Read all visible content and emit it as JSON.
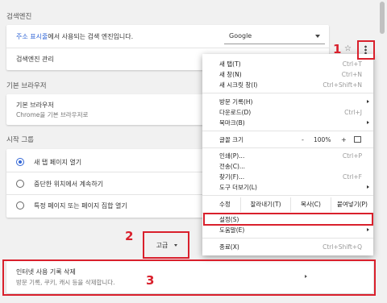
{
  "search_engine": {
    "section_title": "검색엔진",
    "row1": {
      "link": "주소 표시줄",
      "rest": "에서 사용되는 검색 엔진입니다.",
      "value": "Google"
    },
    "row2": {
      "label": "검색엔진 관리"
    }
  },
  "default_browser": {
    "section_title": "기본 브라우저",
    "title": "기본 브라우저",
    "subtitle": "Chrome을 기본 브라우저로"
  },
  "startup": {
    "section_title": "시작 그룹",
    "options": [
      "새 탭 페이지 열기",
      "중단한 위치에서 계속하기",
      "특정 페이지 또는 페이지 집합 열기"
    ],
    "selected_index": 0
  },
  "advanced": {
    "label": "고급"
  },
  "clear_data": {
    "title": "인터넷 사용 기록 삭제",
    "subtitle": "방문 기록, 쿠키, 캐시 등을 삭제합니다."
  },
  "menu": {
    "items_top": [
      {
        "label": "새 탭(T)",
        "shortcut": "Ctrl+T"
      },
      {
        "label": "새 창(N)",
        "shortcut": "Ctrl+N"
      },
      {
        "label": "새 시크릿 창(I)",
        "shortcut": "Ctrl+Shift+N"
      }
    ],
    "items_mid": [
      {
        "label": "방문 기록(H)",
        "shortcut": ""
      },
      {
        "label": "다운로드(D)",
        "shortcut": "Ctrl+J"
      },
      {
        "label": "북마크(B)",
        "shortcut": ""
      }
    ],
    "zoom": {
      "label": "글꼴 크기",
      "minus": "-",
      "value": "100%",
      "plus": "+"
    },
    "items_tools": [
      {
        "label": "인쇄(P)...",
        "shortcut": "Ctrl+P"
      },
      {
        "label": "전송(C)...",
        "shortcut": ""
      },
      {
        "label": "찾기(F)...",
        "shortcut": "Ctrl+F"
      },
      {
        "label": "도구 더보기(L)",
        "shortcut": ""
      }
    ],
    "edit": {
      "label": "수정",
      "cut": "잘라내기(T)",
      "copy": "복사(C)",
      "paste": "붙여넣기(P)"
    },
    "settings": {
      "label": "설정(S)"
    },
    "help": {
      "label": "도움말(E)"
    },
    "exit": {
      "label": "종료(X)",
      "shortcut": "Ctrl+Shift+Q"
    }
  },
  "annotations": {
    "n1": "1",
    "n2": "2",
    "n3": "3"
  },
  "colors": {
    "accent": "#3367d6",
    "highlight": "#d9202c"
  }
}
